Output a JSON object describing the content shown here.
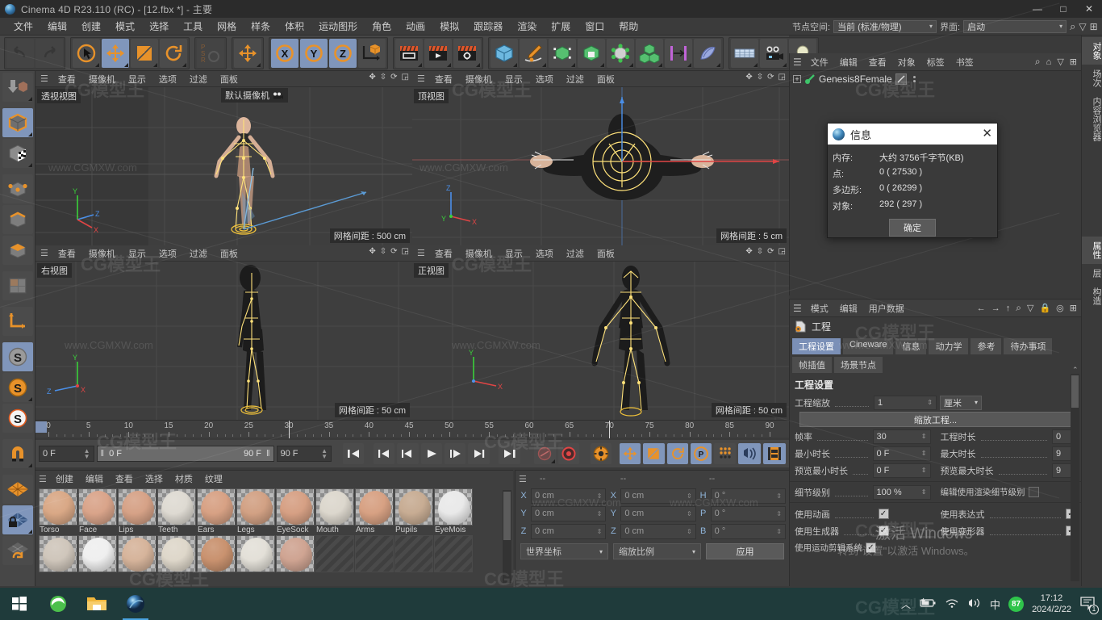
{
  "window": {
    "title": "Cinema 4D R23.110 (RC) - [12.fbx *] - 主要",
    "minimize": "—",
    "maximize": "□",
    "close": "✕"
  },
  "menubar": {
    "items": [
      "文件",
      "编辑",
      "创建",
      "模式",
      "选择",
      "工具",
      "网格",
      "样条",
      "体积",
      "运动图形",
      "角色",
      "动画",
      "模拟",
      "跟踪器",
      "渲染",
      "扩展",
      "窗口",
      "帮助"
    ]
  },
  "topright": {
    "node_space_label": "节点空间:",
    "node_space_value": "当前 (标准/物理)",
    "layout_label": "界面:",
    "layout_value": "启动"
  },
  "object_manager": {
    "menu": [
      "文件",
      "编辑",
      "查看",
      "对象",
      "标签",
      "书签"
    ],
    "objects": [
      {
        "name": "Genesis8Female"
      }
    ]
  },
  "attribute_manager": {
    "menu": [
      "模式",
      "编辑",
      "用户数据"
    ],
    "object_title": "工程",
    "tabs": [
      "工程设置",
      "Cineware",
      "信息",
      "动力学",
      "参考",
      "待办事项",
      "帧插值",
      "场景节点"
    ],
    "active_tab": "工程设置",
    "section_title": "工程设置",
    "fields": {
      "project_scale_label": "工程缩放",
      "project_scale_value": "1",
      "project_scale_unit": "厘米",
      "scale_project_button": "缩放工程...",
      "fps_label": "帧率",
      "fps_value": "30",
      "project_length_label": "工程时长",
      "project_length_value": "0",
      "min_time_label": "最小时长",
      "min_time_value": "0 F",
      "max_time_label": "最大时长",
      "max_time_value": "9",
      "preview_min_label": "预览最小时长",
      "preview_min_value": "0 F",
      "preview_max_label": "预览最大时长",
      "preview_max_value": "9",
      "lod_label": "细节级别",
      "lod_value": "100 %",
      "render_lod_label": "编辑使用渲染细节级别",
      "use_animation_label": "使用动画",
      "use_expression_label": "使用表达式",
      "use_generator_label": "使用生成器",
      "use_deformer_label": "使用变形器",
      "use_motion_clip_label": "使用运动剪辑系统"
    }
  },
  "vertical_tabs": {
    "top": [
      "对象",
      "场次",
      "内容浏览器"
    ],
    "bottom": [
      "属性",
      "层",
      "构造"
    ]
  },
  "dialog": {
    "title": "信息",
    "rows": [
      {
        "key": "内存:",
        "value": "大约 3756千字节(KB)"
      },
      {
        "key": "点:",
        "value": "0 ( 27530 )"
      },
      {
        "key": "多边形:",
        "value": "0 ( 26299 )"
      },
      {
        "key": "对象:",
        "value": "292 ( 297 )"
      }
    ],
    "ok": "确定",
    "close": "✕"
  },
  "viewports": {
    "menu": [
      "查看",
      "摄像机",
      "显示",
      "选项",
      "过滤",
      "面板"
    ],
    "panels": [
      {
        "name": "透视视图",
        "grid": "网格间距 : 500 cm",
        "camera": "默认摄像机"
      },
      {
        "name": "顶视图",
        "grid": "网格间距 : 5 cm",
        "camera": ""
      },
      {
        "name": "右视图",
        "grid": "网格间距 : 50 cm",
        "camera": ""
      },
      {
        "name": "正视图",
        "grid": "网格间距 : 50 cm",
        "camera": ""
      }
    ],
    "axis": {
      "x": "X",
      "y": "Y",
      "z": "Z"
    }
  },
  "timeline": {
    "ticks": [
      0,
      5,
      10,
      15,
      20,
      25,
      30,
      35,
      40,
      45,
      50,
      55,
      60,
      65,
      70,
      75,
      80,
      85,
      90
    ],
    "current_frame": "0 F",
    "range_start": "0 F",
    "range_end": "90 F",
    "end_frame": "90 F",
    "right_frame": "0 F"
  },
  "material_manager": {
    "menu": [
      "创建",
      "编辑",
      "查看",
      "选择",
      "材质",
      "纹理"
    ],
    "materials": [
      {
        "name": "Torso",
        "color": "#d9a886"
      },
      {
        "name": "Face",
        "color": "#d9a48a"
      },
      {
        "name": "Lips",
        "color": "#d6a287"
      },
      {
        "name": "Teeth",
        "color": "#dedad2"
      },
      {
        "name": "Ears",
        "color": "#d7a184"
      },
      {
        "name": "Legs",
        "color": "#d2a184"
      },
      {
        "name": "EyeSock",
        "color": "#d6a084"
      },
      {
        "name": "Mouth",
        "color": "#dcd7cd"
      },
      {
        "name": "Arms",
        "color": "#d7a183"
      },
      {
        "name": "Pupils",
        "color": "#c7ac93"
      },
      {
        "name": "EyeMois",
        "color": "#e9e9e9"
      }
    ],
    "row2": [
      {
        "name": "",
        "color": "#cfc6bb"
      },
      {
        "name": "",
        "color": "#efefef"
      },
      {
        "name": "",
        "color": "#d6b49b"
      },
      {
        "name": "",
        "color": "#ded7ca"
      },
      {
        "name": "",
        "color": "#c9926f"
      },
      {
        "name": "",
        "color": "#e3e0d8"
      },
      {
        "name": "",
        "color": "#cfa492"
      }
    ],
    "empty_slots": 4
  },
  "coordinates": {
    "headers": [
      "--",
      "--",
      "--"
    ],
    "rows": [
      {
        "pos_axis": "X",
        "pos": "0 cm",
        "size_axis": "X",
        "size": "0 cm",
        "rot_axis": "H",
        "rot": "0 °"
      },
      {
        "pos_axis": "Y",
        "pos": "0 cm",
        "size_axis": "Y",
        "size": "0 cm",
        "rot_axis": "P",
        "rot": "0 °"
      },
      {
        "pos_axis": "Z",
        "pos": "0 cm",
        "size_axis": "Z",
        "size": "0 cm",
        "rot_axis": "B",
        "rot": "0 °"
      }
    ],
    "world_select": "世界坐标",
    "scale_select": "缩放比例",
    "apply_button": "应用"
  },
  "watermarks": {
    "small": "www.CGMXW.com",
    "big": "CG模型王",
    "windows_activate_1": "激活 Windows",
    "windows_activate_2": "转到\"设置\"以激活 Windows。"
  },
  "taskbar": {
    "start": "start-icon",
    "apps": [
      "browser-icon",
      "file-explorer-icon",
      "cinema4d-icon"
    ],
    "tray": {
      "chevron": "︿",
      "ime": "中",
      "badge": "87"
    },
    "time": "17:12",
    "date": "2024/2/22"
  },
  "colors": {
    "accent_orange": "#e8922a",
    "select_blue": "#8096bb",
    "panel_bg": "#3a3a3a",
    "toolbar_bg": "#474747",
    "green": "#2fc44b"
  }
}
